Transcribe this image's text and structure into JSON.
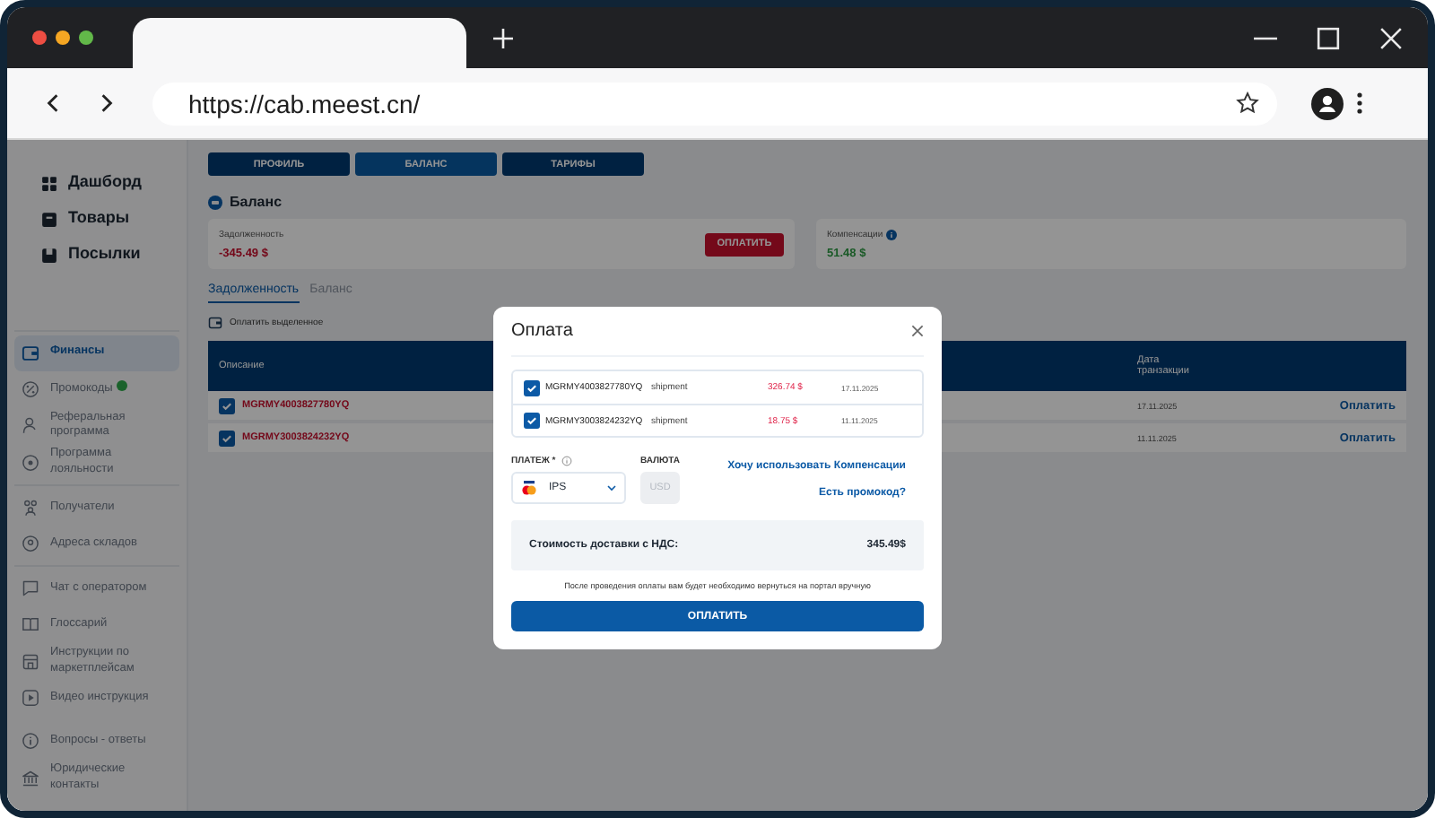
{
  "browser": {
    "url": "https://cab.meest.cn/"
  },
  "sidebar": {
    "sections": [
      {
        "kind": "main",
        "items": [
          {
            "label": "Дашборд",
            "selected": false,
            "badge": false
          },
          {
            "label": "Товары",
            "selected": false,
            "badge": false
          },
          {
            "label": "Посылки",
            "selected": false,
            "badge": false
          }
        ]
      },
      {
        "kind": "menu",
        "items": [
          {
            "label": "Финансы",
            "selected": true,
            "badge": false
          },
          {
            "label": "Промокоды",
            "selected": false,
            "badge": true
          },
          {
            "label": "Реферальная программа",
            "selected": false,
            "badge": false
          },
          {
            "label": "Программа лояльности",
            "selected": false,
            "badge": false
          }
        ]
      },
      {
        "kind": "menu",
        "items": [
          {
            "label": "Получатели",
            "selected": false,
            "badge": false
          },
          {
            "label": "Адреса складов",
            "selected": false,
            "badge": false
          }
        ]
      },
      {
        "kind": "menu",
        "items": [
          {
            "label": "Чат с оператором",
            "selected": false,
            "badge": false
          },
          {
            "label": "Глоссарий",
            "selected": false,
            "badge": false
          },
          {
            "label": "Инструкции по маркетплейсам",
            "selected": false,
            "badge": false
          },
          {
            "label": "Видео инструкция",
            "selected": false,
            "badge": false
          }
        ]
      },
      {
        "kind": "footer",
        "items": [
          {
            "label": "Вопросы - ответы",
            "selected": false,
            "badge": false
          },
          {
            "label": "Юридические контакты",
            "selected": false,
            "badge": false
          }
        ]
      }
    ]
  },
  "top_tabs": [
    {
      "label": "ПРОФИЛЬ",
      "selected": false
    },
    {
      "label": "БАЛАНС",
      "selected": true
    },
    {
      "label": "ТАРИФЫ",
      "selected": false
    }
  ],
  "balance": {
    "title": "Баланс",
    "debt": {
      "label": "Задолженность",
      "value": "-345.49 $",
      "button": "ОПЛАТИТЬ"
    },
    "compensation": {
      "label": "Компенсации",
      "value": "51.48 $"
    }
  },
  "tabs": [
    {
      "label": "Задолженность",
      "selected": true
    },
    {
      "label": "Баланс",
      "selected": false
    }
  ],
  "pay_selected": "Оплатить выделенное",
  "table": {
    "columns": [
      "Описание",
      "Дата транзакции"
    ],
    "rows": [
      {
        "checked": true,
        "code": "MGRMY4003827780YQ",
        "date": "17.11.2025",
        "action": "Оплатить"
      },
      {
        "checked": true,
        "code": "MGRMY3003824232YQ",
        "date": "11.11.2025",
        "action": "Оплатить"
      }
    ]
  },
  "modal": {
    "title": "Оплата",
    "items": [
      {
        "checked": true,
        "code": "MGRMY4003827780YQ",
        "type": "shipment",
        "amount": "326.74 $",
        "date": "17.11.2025"
      },
      {
        "checked": true,
        "code": "MGRMY3003824232YQ",
        "type": "shipment",
        "amount": "18.75 $",
        "date": "11.11.2025"
      }
    ],
    "payment": {
      "label": "ПЛАТЕЖ *",
      "value": "IPS"
    },
    "currency": {
      "label": "ВАЛЮТА",
      "value": "USD",
      "disabled": true
    },
    "links": [
      "Хочу использовать Компенсации",
      "Есть промокод?"
    ],
    "summary": {
      "label": "Стоимость доставки с НДС:",
      "value": "345.49$"
    },
    "note": "После проведения оплаты вам будет необходимо вернуться на портал вручную",
    "button": "ОПЛАТИТЬ"
  }
}
